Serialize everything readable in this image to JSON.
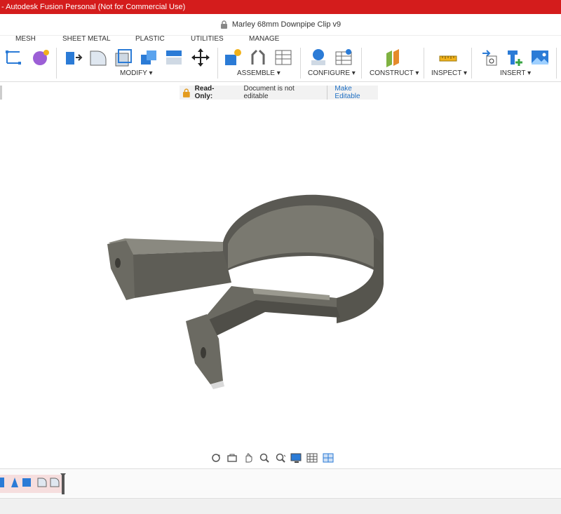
{
  "window": {
    "title": "- Autodesk Fusion Personal (Not for Commercial Use)"
  },
  "document": {
    "title": "Marley 68mm Downpipe Clip v9",
    "lock_icon": "lock-icon"
  },
  "tabs": [
    "MESH",
    "SHEET METAL",
    "PLASTIC",
    "UTILITIES",
    "MANAGE"
  ],
  "ribbon_groups": {
    "modify": "MODIFY ▾",
    "assemble": "ASSEMBLE ▾",
    "configure": "CONFIGURE ▾",
    "construct": "CONSTRUCT ▾",
    "inspect": "INSPECT ▾",
    "insert": "INSERT ▾"
  },
  "banner": {
    "label": "Read-Only:",
    "message": "Document is not editable",
    "action": "Make Editable"
  },
  "colors": {
    "titlebar": "#d41c1c",
    "model": "#6b6a62",
    "accent": "#1f6fc2"
  }
}
